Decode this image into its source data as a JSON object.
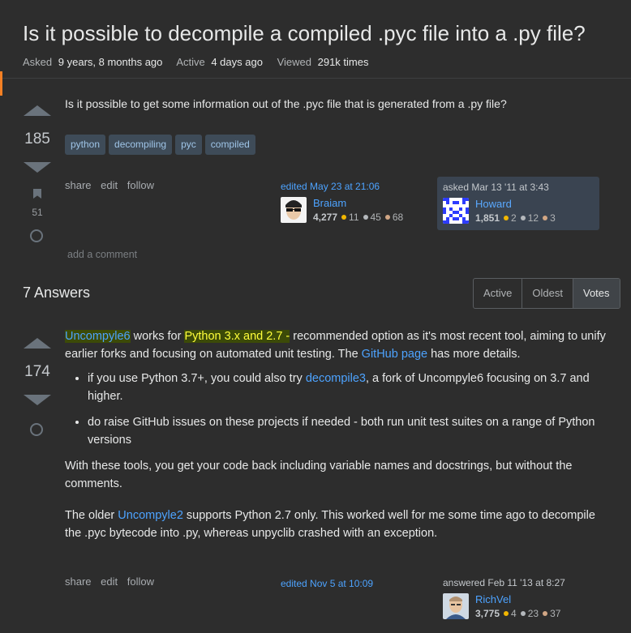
{
  "question": {
    "title": "Is it possible to decompile a compiled .pyc file into a .py file?",
    "asked_label": "Asked",
    "asked_value": "9 years, 8 months ago",
    "active_label": "Active",
    "active_value": "4 days ago",
    "viewed_label": "Viewed",
    "viewed_value": "291k times",
    "votes": "185",
    "bookmarks": "51",
    "body": "Is it possible to get some information out of the .pyc file that is generated from a .py file?",
    "tags": [
      "python",
      "decompiling",
      "pyc",
      "compiled"
    ],
    "actions": [
      "share",
      "edit",
      "follow"
    ],
    "editor": {
      "edited": "edited May 23 at 21:06",
      "name": "Braiam",
      "rep": "4,277",
      "gold": "11",
      "silver": "45",
      "bronze": "68"
    },
    "asker": {
      "asked": "asked Mar 13 '11 at 3:43",
      "name": "Howard",
      "rep": "1,851",
      "gold": "2",
      "silver": "12",
      "bronze": "3"
    },
    "add_comment": "add a comment"
  },
  "answers_header": "7 Answers",
  "sort_tabs": [
    "Active",
    "Oldest",
    "Votes"
  ],
  "answer": {
    "votes": "174",
    "p1_link1": "Uncompyle6",
    "p1_t1": " works for ",
    "p1_hl": "Python 3.x and 2.7 -",
    "p1_t2": " recommended option as it's most recent tool, aiming to unify earlier forks and focusing on automated unit testing. The ",
    "p1_link2": "GitHub page",
    "p1_t3": " has more details.",
    "li1_t1": "if you use Python 3.7+, you could also try ",
    "li1_link": "decompile3",
    "li1_t2": ", a fork of Uncompyle6 focusing on 3.7 and higher.",
    "li2": "do raise GitHub issues on these projects if needed - both run unit test suites on a range of Python versions",
    "p2": "With these tools, you get your code back including variable names and docstrings, but without the comments.",
    "p3_t1": "The older ",
    "p3_link": "Uncompyle2",
    "p3_t2": " supports Python 2.7 only. This worked well for me some time ago to decompile the .pyc bytecode into .py, whereas unpyclib crashed with an exception.",
    "actions": [
      "share",
      "edit",
      "follow"
    ],
    "edited": "edited Nov 5 at 10:09",
    "answerer": {
      "answered": "answered Feb 11 '13 at 8:27",
      "name": "RichVel",
      "rep": "3,775",
      "gold": "4",
      "silver": "23",
      "bronze": "37"
    }
  }
}
